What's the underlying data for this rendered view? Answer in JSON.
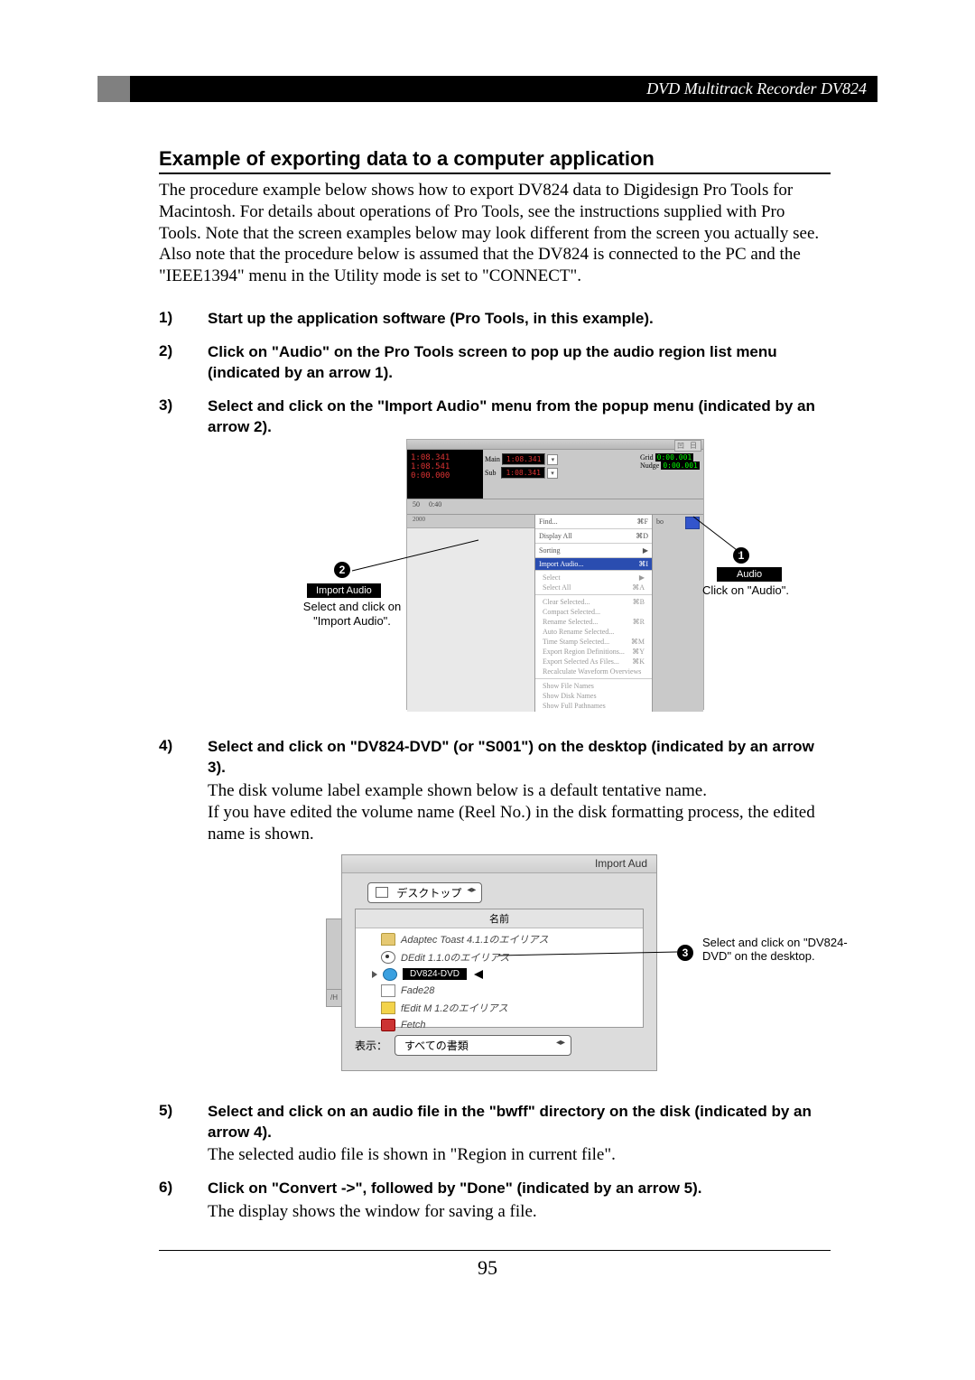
{
  "header": {
    "title": "DVD Multitrack Recorder DV824"
  },
  "section_title": "Example of exporting data to a computer application",
  "intro": "The procedure example below shows how to export DV824 data to Digidesign Pro Tools for Macintosh. For details about operations of Pro Tools, see the instructions supplied with Pro Tools.  Note that the screen examples below may look different from the screen you actually see.  Also note that the procedure below is assumed that the DV824 is connected to the PC and the \"IEEE1394\" menu in the Utility mode is set to \"CONNECT\".",
  "steps": [
    {
      "num": "1)",
      "bold": "Start up the application software (Pro Tools, in this example)."
    },
    {
      "num": "2)",
      "bold": "Click on \"Audio\" on the Pro Tools screen to pop up the audio region list menu (indicated by an arrow 1)."
    },
    {
      "num": "3)",
      "bold": "Select and click on the \"Import Audio\" menu from the popup menu (indicated by an arrow 2)."
    },
    {
      "num": "4)",
      "bold": "Select and click on \"DV824-DVD\" (or \"S001\") on the desktop (indicated by an arrow 3).",
      "desc": "The disk volume label example shown below is a default tentative name.\nIf you have edited the volume name (Reel No.) in the disk formatting process, the edited name is shown."
    },
    {
      "num": "5)",
      "bold": "Select and click on an audio file in the \"bwff\" directory on the disk (indicated by an arrow 4).",
      "desc": "The selected audio file is shown in \"Region in current file\"."
    },
    {
      "num": "6)",
      "bold": "Click on \"Convert ->\", followed by \"Done\" (indicated by an arrow 5).",
      "desc": "The display shows the window for saving a file."
    }
  ],
  "fig1": {
    "callout1": {
      "badge": "1",
      "box": "Audio",
      "text": "Click on \"Audio\"."
    },
    "callout2": {
      "badge": "2",
      "box": "Import Audio",
      "text": "Select and click on \"Import Audio\"."
    },
    "counter_lines": [
      "1:08.341",
      "1:08.541",
      "0:00.000"
    ],
    "mid": {
      "main_label": "Main",
      "main_val": "1:08.341",
      "sub_label": "Sub",
      "sub_val": "1:08.341"
    },
    "right": {
      "grid": "Grid",
      "grid_val": "0:00.001",
      "nudge": "Nudge",
      "nudge_val": "0:00.001"
    },
    "ruler": {
      "a": "50",
      "b": "0:40",
      "c": "2000"
    },
    "menu": {
      "top": [
        {
          "l": "Find...",
          "r": "⌘F"
        },
        {
          "l": "Display All",
          "r": "⌘D"
        },
        {
          "l": "Sorting",
          "r": "▶"
        }
      ],
      "hl": {
        "l": "Import Audio...",
        "r": "⌘I"
      },
      "sec1": [
        {
          "l": "Select",
          "r": "▶"
        },
        {
          "l": "Select All",
          "r": "⌘A"
        }
      ],
      "sec2": [
        {
          "l": "Clear Selected...",
          "r": "⌘B"
        },
        {
          "l": "Compact Selected...",
          "r": ""
        },
        {
          "l": "Rename Selected...",
          "r": "⌘R"
        },
        {
          "l": "Auto Rename Selected...",
          "r": ""
        },
        {
          "l": "Time Stamp Selected...",
          "r": "⌘M"
        },
        {
          "l": "Export Region Definitions...",
          "r": "⌘Y"
        },
        {
          "l": "Export Selected As Files...",
          "r": "⌘K"
        },
        {
          "l": "Recalculate Waveform Overviews",
          "r": ""
        }
      ],
      "sec3": [
        "Show File Names",
        "Show Disk Names",
        "Show Full Pathnames"
      ]
    },
    "rightcol_label": "bo"
  },
  "fig2": {
    "title": "Import Aud",
    "select_top": "デスクトップ",
    "list_head": "名前",
    "rows": [
      {
        "icon": "folder",
        "text": "Adaptec Toast 4.1.1のエイリアス"
      },
      {
        "icon": "eye",
        "text": "DEdit 1.1.0のエイリアス"
      },
      {
        "icon": "disc",
        "hl": true,
        "text": "DV824-DVD"
      },
      {
        "icon": "page",
        "text": "Fade28"
      },
      {
        "icon": "app",
        "text": "fEdit M 1.2のエイリアス"
      },
      {
        "icon": "dog",
        "text": "Fetch"
      }
    ],
    "bottom_label": "表示：",
    "bottom_select": "すべての書類",
    "left_tab": "/H",
    "callout3": {
      "badge": "3",
      "text": "Select and click on \"DV824-DVD\" on the desktop."
    }
  },
  "page_number": "95"
}
